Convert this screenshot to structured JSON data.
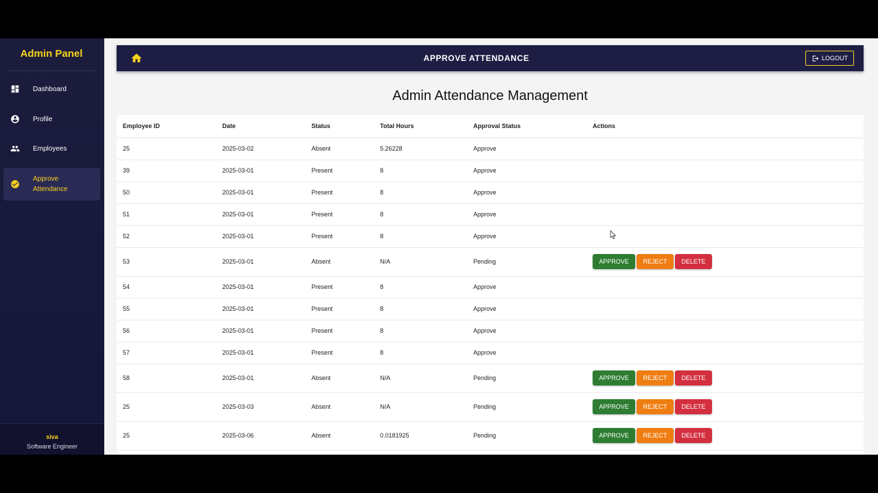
{
  "sidebar": {
    "title": "Admin Panel",
    "items": [
      {
        "label": "Dashboard",
        "icon": "dashboard-icon"
      },
      {
        "label": "Profile",
        "icon": "account-circle-icon"
      },
      {
        "label": "Employees",
        "icon": "people-icon"
      },
      {
        "label": "Approve Attendance",
        "icon": "check-circle-icon"
      }
    ],
    "footer": {
      "user": "siva",
      "role": "Software Engineer"
    }
  },
  "topbar": {
    "title": "APPROVE ATTENDANCE",
    "logout_label": "LOGOUT"
  },
  "page": {
    "title": "Admin Attendance Management"
  },
  "table": {
    "headers": [
      "Employee ID",
      "Date",
      "Status",
      "Total Hours",
      "Approval Status",
      "Actions"
    ],
    "rows": [
      {
        "id": "25",
        "date": "2025-03-02",
        "status": "Absent",
        "hours": "5.26228",
        "approval": "Approve"
      },
      {
        "id": "39",
        "date": "2025-03-01",
        "status": "Present",
        "hours": "8",
        "approval": "Approve"
      },
      {
        "id": "50",
        "date": "2025-03-01",
        "status": "Present",
        "hours": "8",
        "approval": "Approve"
      },
      {
        "id": "51",
        "date": "2025-03-01",
        "status": "Present",
        "hours": "8",
        "approval": "Approve"
      },
      {
        "id": "52",
        "date": "2025-03-01",
        "status": "Present",
        "hours": "8",
        "approval": "Approve"
      },
      {
        "id": "53",
        "date": "2025-03-01",
        "status": "Absent",
        "hours": "N/A",
        "approval": "Pending"
      },
      {
        "id": "54",
        "date": "2025-03-01",
        "status": "Present",
        "hours": "8",
        "approval": "Approve"
      },
      {
        "id": "55",
        "date": "2025-03-01",
        "status": "Present",
        "hours": "8",
        "approval": "Approve"
      },
      {
        "id": "56",
        "date": "2025-03-01",
        "status": "Present",
        "hours": "8",
        "approval": "Approve"
      },
      {
        "id": "57",
        "date": "2025-03-01",
        "status": "Present",
        "hours": "8",
        "approval": "Approve"
      },
      {
        "id": "58",
        "date": "2025-03-01",
        "status": "Absent",
        "hours": "N/A",
        "approval": "Pending"
      },
      {
        "id": "25",
        "date": "2025-03-03",
        "status": "Absent",
        "hours": "N/A",
        "approval": "Pending"
      },
      {
        "id": "25",
        "date": "2025-03-06",
        "status": "Absent",
        "hours": "0.0181925",
        "approval": "Pending"
      }
    ],
    "actions": {
      "approve": "APPROVE",
      "reject": "REJECT",
      "delete": "DELETE"
    }
  },
  "colors": {
    "accent": "#f7d21d",
    "sidebar_bg": "#1c1c3c",
    "approve": "#2e7d32",
    "reject": "#ef7d12",
    "delete": "#d32f3f"
  }
}
